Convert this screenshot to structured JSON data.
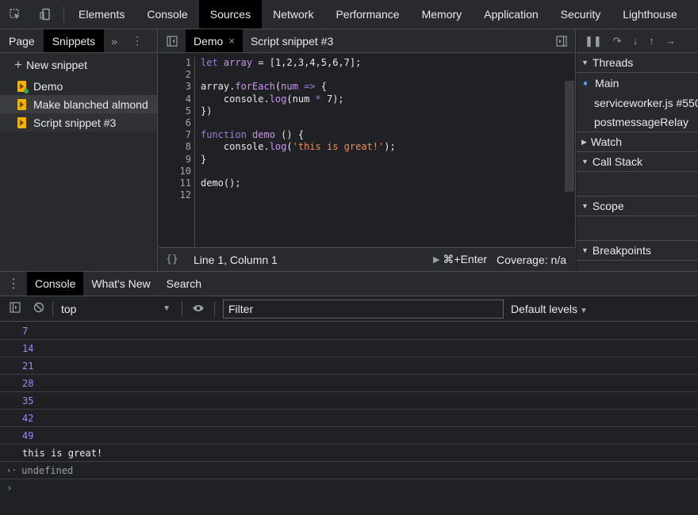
{
  "topbar": {
    "tabs": [
      "Elements",
      "Console",
      "Sources",
      "Network",
      "Performance",
      "Memory",
      "Application",
      "Security",
      "Lighthouse"
    ],
    "active_tab": "Sources"
  },
  "left_panel": {
    "tabs": [
      "Page",
      "Snippets"
    ],
    "active_tab": "Snippets",
    "more": "»",
    "new_snippet": "New snippet",
    "snippets": [
      "Demo",
      "Make blanched almond",
      "Script snippet #3"
    ]
  },
  "editor": {
    "tabs": [
      {
        "label": "Demo",
        "close": "×"
      },
      {
        "label": "Script snippet #3"
      }
    ],
    "line_numbers": [
      "1",
      "2",
      "3",
      "4",
      "5",
      "6",
      "7",
      "8",
      "9",
      "10",
      "11",
      "12"
    ],
    "status": {
      "braces": "{}",
      "position": "Line 1, Column 1",
      "run": "⌘+Enter",
      "coverage": "Coverage: n/a"
    }
  },
  "right_panel": {
    "sections": {
      "threads": "Threads",
      "watch": "Watch",
      "call_stack": "Call Stack",
      "scope": "Scope",
      "breakpoints": "Breakpoints"
    },
    "threads": [
      "Main",
      "serviceworker.js #550",
      "postmessageRelay"
    ]
  },
  "drawer": {
    "tabs": [
      "Console",
      "What's New",
      "Search"
    ],
    "active_tab": "Console"
  },
  "console": {
    "context": "top",
    "filter_placeholder": "Filter",
    "levels": "Default levels",
    "output_numbers": [
      "7",
      "14",
      "21",
      "28",
      "35",
      "42",
      "49"
    ],
    "output_text": "this is great!",
    "result": "undefined",
    "result_mark": "‹·",
    "prompt": "›"
  },
  "colors": {
    "background": "#202124",
    "panel": "#292a2d",
    "keyword": "#9a7fd5",
    "string": "#f28b54",
    "console_number": "#9a8bf5",
    "accent": "#5a9cf8"
  }
}
